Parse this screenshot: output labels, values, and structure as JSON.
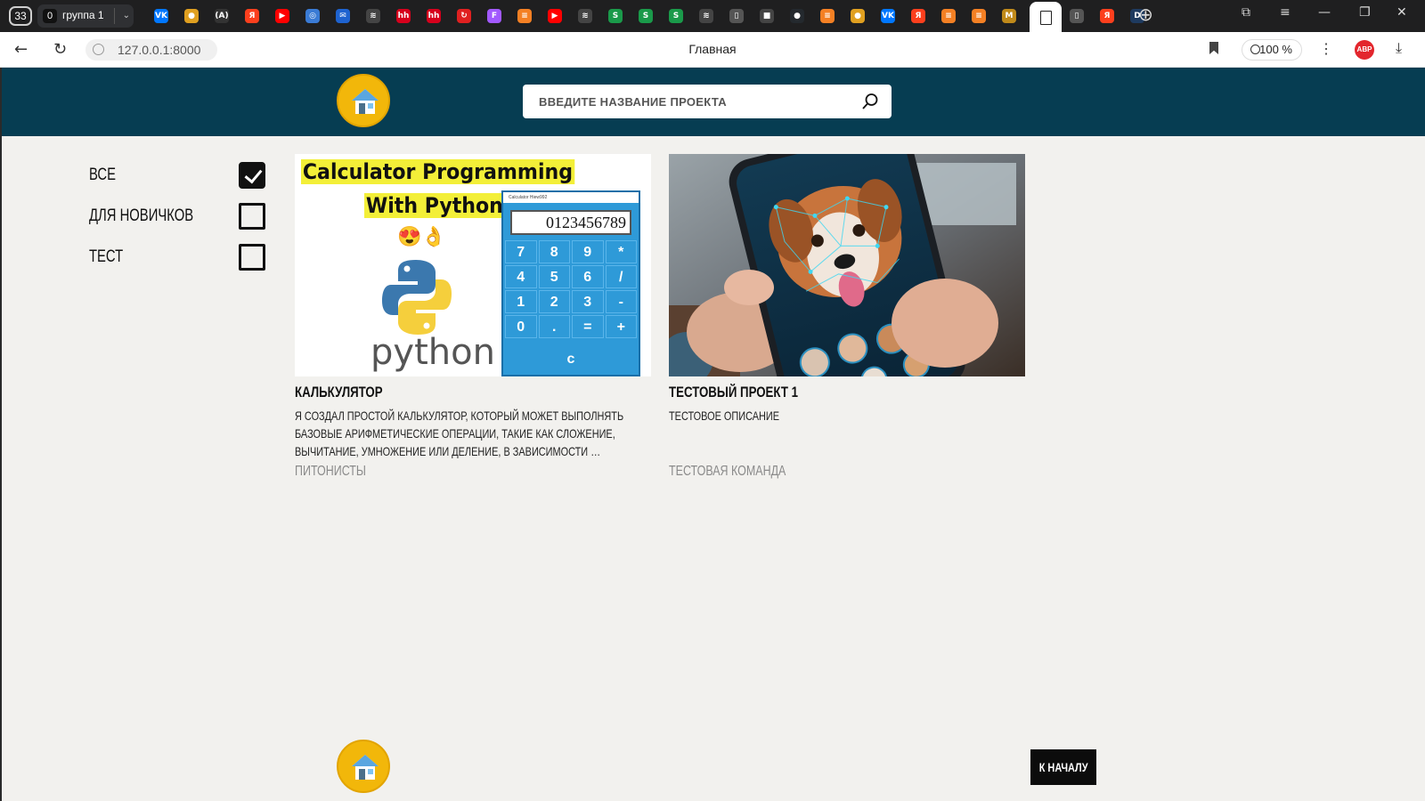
{
  "browser": {
    "tab_count": "33",
    "tab_group": {
      "badge": "0",
      "name": "группа 1"
    },
    "tab_icons": [
      {
        "name": "vk-tab-icon",
        "glyph": "VK",
        "color": "#0077ff"
      },
      {
        "name": "circle-tab-icon",
        "glyph": "●",
        "color": "#e0a020"
      },
      {
        "name": "a-tab-icon",
        "glyph": "(A)",
        "color": "#333333"
      },
      {
        "name": "yandex-tab-icon",
        "glyph": "Я",
        "color": "#fc3f1d"
      },
      {
        "name": "youtube-tab-icon",
        "glyph": "▶",
        "color": "#ff0000"
      },
      {
        "name": "target-tab-icon",
        "glyph": "◎",
        "color": "#3a7bd5"
      },
      {
        "name": "mail-tab-icon",
        "glyph": "✉",
        "color": "#1e63d0"
      },
      {
        "name": "gray-tab-icon",
        "glyph": "≋",
        "color": "#444444"
      },
      {
        "name": "hh-tab-icon",
        "glyph": "hh",
        "color": "#d6001c"
      },
      {
        "name": "hh-tab-icon",
        "glyph": "hh",
        "color": "#d6001c"
      },
      {
        "name": "red-tab-icon",
        "glyph": "↻",
        "color": "#e02020"
      },
      {
        "name": "figma-tab-icon",
        "glyph": "F",
        "color": "#a259ff"
      },
      {
        "name": "stack-tab-icon",
        "glyph": "≡",
        "color": "#f48024"
      },
      {
        "name": "youtube-tab-icon",
        "glyph": "▶",
        "color": "#ff0000"
      },
      {
        "name": "gray-tab-icon",
        "glyph": "≋",
        "color": "#444444"
      },
      {
        "name": "s-tab-icon",
        "glyph": "S",
        "color": "#1a9a4a"
      },
      {
        "name": "s-tab-icon",
        "glyph": "S",
        "color": "#1a9a4a"
      },
      {
        "name": "s-tab-icon",
        "glyph": "S",
        "color": "#1a9a4a"
      },
      {
        "name": "gray-tab-icon",
        "glyph": "≋",
        "color": "#444444"
      },
      {
        "name": "document-tab-icon",
        "glyph": "▯",
        "color": "#555555"
      },
      {
        "name": "box-tab-icon",
        "glyph": "■",
        "color": "#444444"
      },
      {
        "name": "github-tab-icon",
        "glyph": "●",
        "color": "#24292e"
      },
      {
        "name": "stack-tab-icon",
        "glyph": "≡",
        "color": "#f48024"
      },
      {
        "name": "circle-tab-icon",
        "glyph": "●",
        "color": "#e0a020"
      },
      {
        "name": "vk-tab-icon",
        "glyph": "VK",
        "color": "#0077ff"
      },
      {
        "name": "yandex-tab-icon",
        "glyph": "Я",
        "color": "#fc3f1d"
      },
      {
        "name": "stack-tab-icon",
        "glyph": "≡",
        "color": "#f48024"
      },
      {
        "name": "stack-tab-icon",
        "glyph": "≡",
        "color": "#f48024"
      },
      {
        "name": "m-tab-icon",
        "glyph": "M",
        "color": "#c08a1a"
      }
    ],
    "right_tab_icons": [
      {
        "name": "document-tab-icon",
        "glyph": "▯",
        "color": "#555555"
      },
      {
        "name": "yandex-tab-icon",
        "glyph": "Я",
        "color": "#fc3f1d"
      },
      {
        "name": "d-tab-icon",
        "glyph": "D",
        "color": "#1e3a5f"
      }
    ],
    "url": "127.0.0.1:8000",
    "page_title": "Главная",
    "zoom": "100 %",
    "abp": "ABP"
  },
  "site": {
    "colors": {
      "header": "#063d52",
      "logo": "#f2b70a",
      "background": "#f2f1ee"
    },
    "search_placeholder": "ВВЕДИТЕ НАЗВАНИЕ ПРОЕКТА",
    "filters": [
      {
        "label": "ВСЕ",
        "checked": true
      },
      {
        "label": "ДЛЯ НОВИЧКОВ",
        "checked": false
      },
      {
        "label": "ТЕСТ",
        "checked": false
      }
    ],
    "projects": [
      {
        "title": "КАЛЬКУЛЯТОР",
        "description": "Я СОЗДАЛ ПРОСТОЙ КАЛЬКУЛЯТОР, КОТОРЫЙ МОЖЕТ ВЫПОЛНЯТЬ БАЗОВЫЕ АРИФМЕТИЧЕСКИЕ ОПЕРАЦИИ, ТАКИЕ КАК СЛОЖЕНИЕ, ВЫЧИТАНИЕ, УМНОЖЕНИЕ ИЛИ ДЕЛЕНИЕ, В ЗАВИСИМОСТИ …",
        "team": "ПИТОНИСТЫ",
        "image": {
          "line1": "Calculator Programming",
          "line2": "With Python",
          "emoji": "😍👌",
          "word": "python",
          "window_title": "Calculator Hiew992",
          "display": "0123456789",
          "keys": [
            "7",
            "8",
            "9",
            "*",
            "4",
            "5",
            "6",
            "/",
            "1",
            "2",
            "3",
            "-",
            "0",
            ".",
            "=",
            "+"
          ],
          "clear": "c"
        }
      },
      {
        "title": "ТЕСТОВЫЙ ПРОЕКТ 1",
        "description": "ТЕСТОВОЕ ОПИСАНИЕ",
        "team": "ТЕСТОВАЯ КОМАНДА",
        "image": {
          "subject": "dog-on-phone-photo"
        }
      }
    ],
    "back_to_top": "К НАЧАЛУ"
  }
}
